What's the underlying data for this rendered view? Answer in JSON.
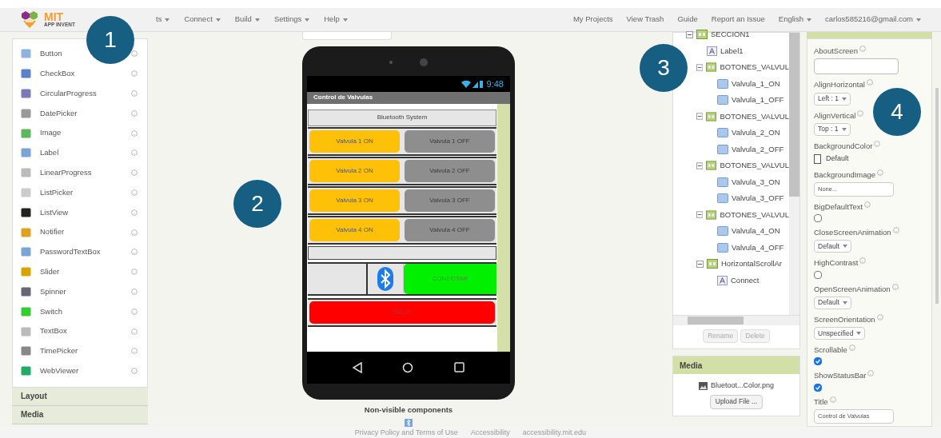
{
  "menu_bar": {
    "logo_title": "MIT",
    "logo_subtitle": "APP INVENT",
    "items": [
      {
        "label": "ts",
        "dropdown": true
      },
      {
        "label": "Connect",
        "dropdown": true
      },
      {
        "label": "Build",
        "dropdown": true
      },
      {
        "label": "Settings",
        "dropdown": true
      },
      {
        "label": "Help",
        "dropdown": true
      }
    ],
    "right_items": [
      {
        "label": "My Projects",
        "dropdown": false
      },
      {
        "label": "View Trash",
        "dropdown": false
      },
      {
        "label": "Guide",
        "dropdown": false
      },
      {
        "label": "Report an Issue",
        "dropdown": false
      },
      {
        "label": "English",
        "dropdown": true
      },
      {
        "label": "carlos585216@gmail.com",
        "dropdown": true
      }
    ]
  },
  "palette": {
    "items": [
      {
        "label": "Button"
      },
      {
        "label": "CheckBox"
      },
      {
        "label": "CircularProgress"
      },
      {
        "label": "DatePicker"
      },
      {
        "label": "Image"
      },
      {
        "label": "Label"
      },
      {
        "label": "LinearProgress"
      },
      {
        "label": "ListPicker"
      },
      {
        "label": "ListView"
      },
      {
        "label": "Notifier"
      },
      {
        "label": "PasswordTextBox"
      },
      {
        "label": "Slider"
      },
      {
        "label": "Spinner"
      },
      {
        "label": "Switch"
      },
      {
        "label": "TextBox"
      },
      {
        "label": "TimePicker"
      },
      {
        "label": "WebViewer"
      }
    ],
    "sections": [
      "Layout",
      "Media"
    ]
  },
  "viewer": {
    "phone": {
      "time": "9:48",
      "title": "Control de Valvulas",
      "header_label": "Bluetooth System",
      "valve_rows": [
        {
          "on": "Valvula 1 ON",
          "off": "Valvula 1 OFF"
        },
        {
          "on": "Valvula 2 ON",
          "off": "Valvula 2 OFF"
        },
        {
          "on": "Valvula 3 ON",
          "off": "Valvula 3 OFF"
        },
        {
          "on": "Valvula 4 ON",
          "off": "Valvula 4 OFF"
        }
      ],
      "connect_button": "CONECTAR",
      "exit_button": "SALIR"
    },
    "non_visible_title": "Non-visible components"
  },
  "footer": {
    "links": [
      "Privacy Policy and Terms of Use",
      "Accessibility",
      "accessibility.mit.edu"
    ]
  },
  "components": {
    "tree": [
      {
        "label": "SECCION1",
        "kind": "arrangement",
        "expanded": true,
        "children": [
          {
            "label": "Label1",
            "kind": "label"
          },
          {
            "label": "BOTONES_VALVUL",
            "kind": "arrangement",
            "expanded": true,
            "children": [
              {
                "label": "Valvula_1_ON",
                "kind": "button"
              },
              {
                "label": "Valvula_1_OFF",
                "kind": "button"
              }
            ]
          },
          {
            "label": "BOTONES_VALVUL",
            "kind": "arrangement",
            "expanded": true,
            "children": [
              {
                "label": "Valvula_2_ON",
                "kind": "button"
              },
              {
                "label": "Valvula_2_OFF",
                "kind": "button"
              }
            ]
          },
          {
            "label": "BOTONES_VALVUL",
            "kind": "arrangement",
            "expanded": true,
            "children": [
              {
                "label": "Valvula_3_ON",
                "kind": "button"
              },
              {
                "label": "Valvula_3_OFF",
                "kind": "button"
              }
            ]
          },
          {
            "label": "BOTONES_VALVUL",
            "kind": "arrangement",
            "expanded": true,
            "children": [
              {
                "label": "Valvula_4_ON",
                "kind": "button"
              },
              {
                "label": "Valvula_4_OFF",
                "kind": "button"
              }
            ]
          },
          {
            "label": "HorizontalScrollAr",
            "kind": "arrangement",
            "expanded": true,
            "children": [
              {
                "label": "Connect",
                "kind": "label"
              }
            ]
          }
        ]
      }
    ],
    "buttons": [
      {
        "label": "Rename",
        "disabled": true
      },
      {
        "label": "Delete",
        "disabled": true
      }
    ]
  },
  "media": {
    "header": "Media",
    "files": [
      "Bluetoot...Color.png"
    ],
    "upload_button": "Upload File ..."
  },
  "properties": {
    "items": [
      {
        "label": "AboutScreen",
        "kind": "textarea"
      },
      {
        "label": "AlignHorizontal",
        "kind": "dropdown",
        "value": "Left : 1"
      },
      {
        "label": "AlignVertical",
        "kind": "dropdown",
        "value": "Top : 1"
      },
      {
        "label": "BackgroundColor",
        "kind": "color",
        "value": "Default"
      },
      {
        "label": "BackgroundImage",
        "kind": "textbox",
        "value": "None..."
      },
      {
        "label": "BigDefaultText",
        "kind": "checkbox",
        "checked": false
      },
      {
        "label": "CloseScreenAnimation",
        "kind": "dropdown",
        "value": "Default"
      },
      {
        "label": "HighContrast",
        "kind": "checkbox",
        "checked": false
      },
      {
        "label": "OpenScreenAnimation",
        "kind": "dropdown",
        "value": "Default"
      },
      {
        "label": "ScreenOrientation",
        "kind": "dropdown",
        "value": "Unspecified"
      },
      {
        "label": "Scrollable",
        "kind": "checkbox",
        "checked": true
      },
      {
        "label": "ShowStatusBar",
        "kind": "checkbox",
        "checked": true
      },
      {
        "label": "Title",
        "kind": "textbox",
        "value": "Control de Valvulas"
      }
    ]
  },
  "callouts": [
    "1",
    "2",
    "3",
    "4"
  ]
}
